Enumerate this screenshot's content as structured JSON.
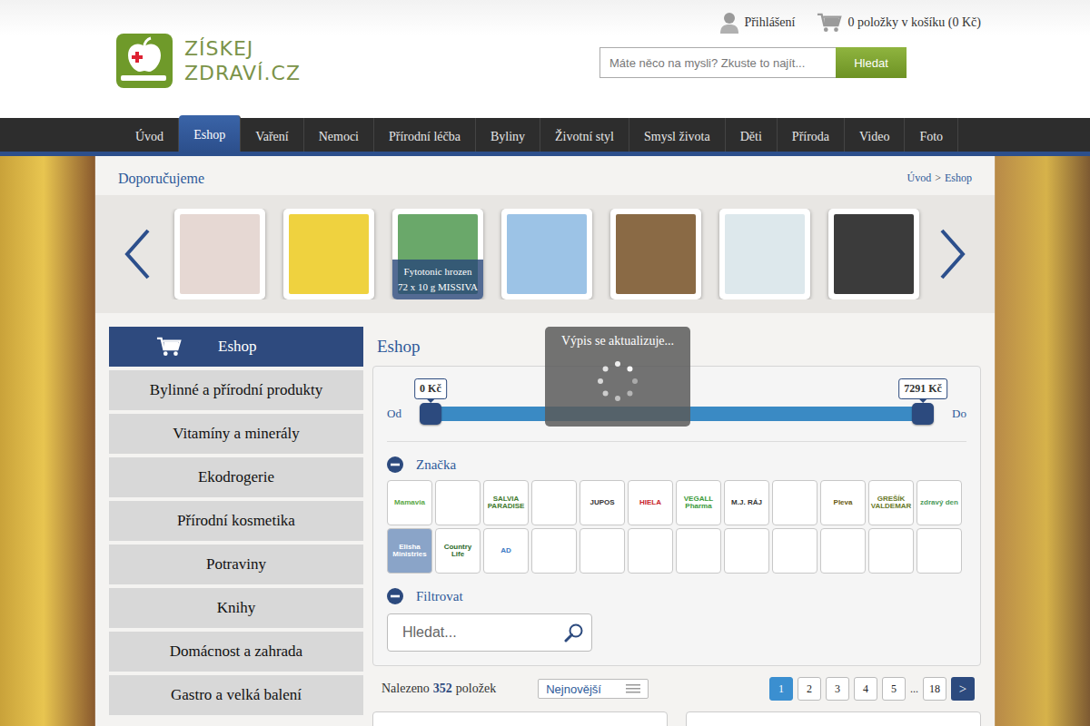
{
  "logo": {
    "line1": "ZÍSKEJ",
    "line2": "ZDRAVÍ.CZ"
  },
  "top_links": {
    "login": "Přihlášení",
    "cart": "0 položky v košíku (0 Kč)"
  },
  "search": {
    "placeholder": "Máte něco na mysli? Zkuste to najít...",
    "button": "Hledat"
  },
  "nav": [
    {
      "label": "Úvod",
      "selected": false
    },
    {
      "label": "Eshop",
      "selected": true
    },
    {
      "label": "Vaření",
      "selected": false
    },
    {
      "label": "Nemoci",
      "selected": false
    },
    {
      "label": "Přírodní léčba",
      "selected": false
    },
    {
      "label": "Byliny",
      "selected": false
    },
    {
      "label": "Životní styl",
      "selected": false
    },
    {
      "label": "Smysl života",
      "selected": false
    },
    {
      "label": "Děti",
      "selected": false
    },
    {
      "label": "Příroda",
      "selected": false
    },
    {
      "label": "Video",
      "selected": false
    },
    {
      "label": "Foto",
      "selected": false
    }
  ],
  "recommended": {
    "title": "Doporučujeme",
    "breadcrumb": [
      "Úvod",
      "Eshop"
    ],
    "separator": ">"
  },
  "carousel": [
    {
      "caption": [],
      "color": "#e6d8d3"
    },
    {
      "caption": [],
      "color": "#efd23f"
    },
    {
      "caption": [
        "Fytotonic hrozen",
        "72 x 10 g MISSIVA"
      ],
      "color": "#6aa86a"
    },
    {
      "caption": [],
      "color": "#9cc3e6"
    },
    {
      "caption": [],
      "color": "#8a6a45"
    },
    {
      "caption": [],
      "color": "#dde8ec"
    },
    {
      "caption": [],
      "color": "#3b3b3b"
    }
  ],
  "sidebar": {
    "header": "Eshop",
    "items": [
      "Bylinné a přírodní produkty",
      "Vitamíny a minerály",
      "Ekodrogerie",
      "Přírodní kosmetika",
      "Potraviny",
      "Knihy",
      "Domácnost a zahrada",
      "Gastro a velká balení"
    ]
  },
  "main": {
    "title": "Eshop"
  },
  "overlay": {
    "text": "Výpis se aktualizuje..."
  },
  "price": {
    "min_label": "0 Kč",
    "max_label": "7291 Kč",
    "from": "Od",
    "to": "Do",
    "low_level": 0,
    "high_level": 1
  },
  "brand_filter": {
    "title": "Značka",
    "expanded": true,
    "brands": [
      {
        "label": "Mamavia",
        "color": "#5aa845"
      },
      {
        "label": "",
        "color": "#1f5fa8"
      },
      {
        "label": "SALVIA PARADISE",
        "color": "#3f7a2e"
      },
      {
        "label": "",
        "color": "#999999"
      },
      {
        "label": "JUPOS",
        "color": "#333333"
      },
      {
        "label": "HIELA",
        "color": "#c8242b"
      },
      {
        "label": "VEGALL Pharma",
        "color": "#3a9a3a"
      },
      {
        "label": "M.J. RÁJ",
        "color": "#333333"
      },
      {
        "label": "",
        "color": "#4a8a9a"
      },
      {
        "label": "Pleva",
        "color": "#6a5a10"
      },
      {
        "label": "GREŠÍK VALDEMAR",
        "color": "#6a7a2a"
      },
      {
        "label": "zdravý den",
        "color": "#4a9a5a"
      },
      {
        "label": "Elisha Ministries",
        "color": "#ffffff"
      },
      {
        "label": "Country Life",
        "color": "#2a6a2a"
      },
      {
        "label": "AD",
        "color": "#3a7ac4"
      },
      {
        "label": "",
        "color": "#999999"
      },
      {
        "label": "",
        "color": "#999999"
      },
      {
        "label": "",
        "color": "#999999"
      },
      {
        "label": "",
        "color": "#999999"
      },
      {
        "label": "",
        "color": "#999999"
      },
      {
        "label": "",
        "color": "#999999"
      },
      {
        "label": "",
        "color": "#999999"
      },
      {
        "label": "",
        "color": "#999999"
      },
      {
        "label": "",
        "color": "#999999"
      }
    ]
  },
  "text_filter": {
    "title": "Filtrovat",
    "expanded": true,
    "placeholder": "Hledat..."
  },
  "results": {
    "prefix": "Nalezeno",
    "count": "352",
    "suffix": "položek",
    "sort": "Nejnovější"
  },
  "pagination": {
    "pages": [
      {
        "label": "1",
        "selected": true
      },
      {
        "label": "2",
        "selected": false
      },
      {
        "label": "3",
        "selected": false
      },
      {
        "label": "4",
        "selected": false
      },
      {
        "label": "5",
        "selected": false
      }
    ],
    "ellipsis": "...",
    "last": "18",
    "next": ">"
  }
}
